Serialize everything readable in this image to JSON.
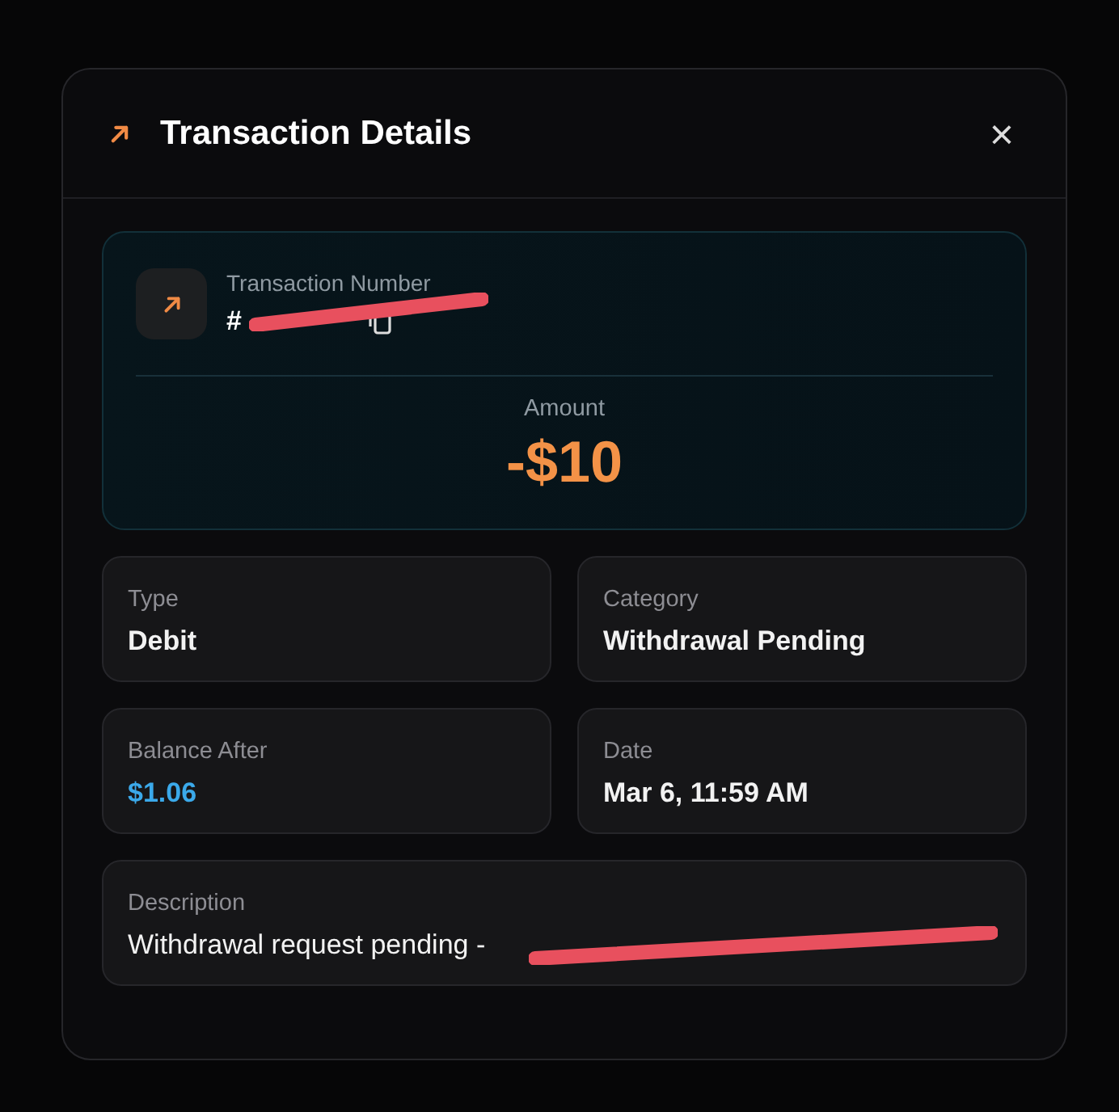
{
  "dialog": {
    "title": "Transaction Details",
    "close_label": "×"
  },
  "transaction": {
    "number_label": "Transaction Number",
    "number": "#",
    "redacted": true,
    "amount_label": "Amount",
    "amount": "-$10"
  },
  "fields": [
    {
      "label": "Type",
      "value": "Debit",
      "color": "#f2f2f2"
    },
    {
      "label": "Category",
      "value": "Withdrawal Pending",
      "color": "#f2f2f2"
    },
    {
      "label": "Balance After",
      "value": "$1.06",
      "color": "#3ba9ea"
    },
    {
      "label": "Date",
      "value": "Mar 6, 11:59 AM",
      "color": "#f2f2f2"
    }
  ],
  "description": {
    "label": "Description",
    "value": "Withdrawal request pending -",
    "redacted": true
  }
}
